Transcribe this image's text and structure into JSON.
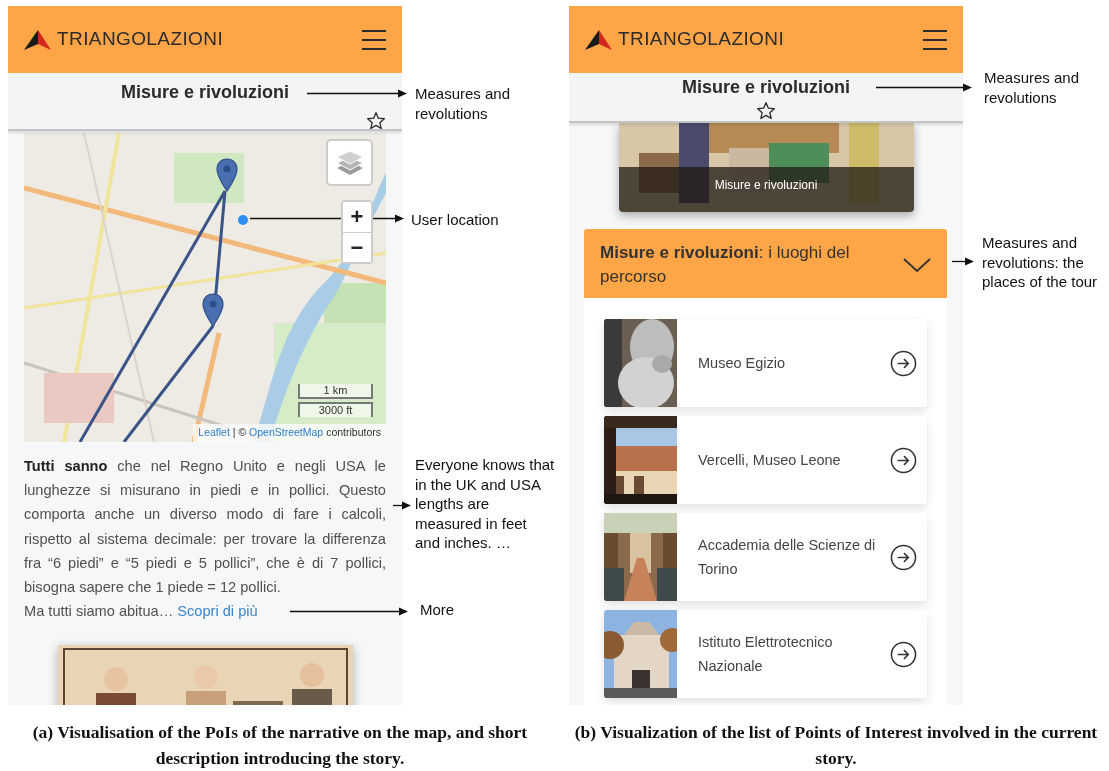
{
  "figure_a": {
    "app_bar": {
      "brand": "TRIANGOLAZIONI"
    },
    "page_title": "Misure e rivoluzioni",
    "favorite": false,
    "map": {
      "zoom_in": "+",
      "zoom_out": "−",
      "scale": [
        "1 km",
        "3000 ft"
      ],
      "attribution": [
        {
          "text": "Leaflet",
          "link": true
        },
        {
          "text": "|",
          "link": false
        },
        {
          "text": "©",
          "link": false
        },
        {
          "text": "OpenStreetMap",
          "link": true
        },
        {
          "text": "contributors",
          "link": false
        }
      ]
    },
    "description": "**Tutti sanno** che nel Regno Unito e negli USA le lunghezze si misurano in piedi e in pollici. Questo comporta anche un diverso modo di fare i calcoli, rispetto al sistema decimale: per trovare la differenza fra “6 piedi” e “5 piedi e 5 pollici”, che è di 7 pollici, bisogna sapere che 1 piede = 12 pollici.",
    "description_tail": "Ma tutti siamo abitua…",
    "more_link": "Scopri di più",
    "annotations": [
      "Measures and revolutions",
      "User location",
      "Everyone knows that in the UK and USA lengths are measured in feet and inches. …",
      "More"
    ],
    "caption": "(a) Visualisation of the PoIs of the narrative on the map, and short description introducing the story."
  },
  "figure_b": {
    "app_bar": {
      "brand": "TRIANGOLAZIONI"
    },
    "page_title": "Misure e rivoluzioni",
    "favorite": false,
    "story_card": {
      "caption": "Misure e rivoluzioni"
    },
    "places_header": {
      "title": "**Misure e rivoluzioni**: i luoghi del percorso",
      "expanded": true
    },
    "places": [
      {
        "name": "Museo Egizio"
      },
      {
        "name": "Vercelli, Museo Leone"
      },
      {
        "name": "Accademia delle Scienze di Torino"
      },
      {
        "name": "Istituto Elettrotecnico Nazionale"
      }
    ],
    "annotations": [
      "Measures and revolutions",
      "Measures and revolutions: the places of the tour"
    ],
    "caption": "(b) Visualization of the list of Points of Interest involved in the current story."
  }
}
